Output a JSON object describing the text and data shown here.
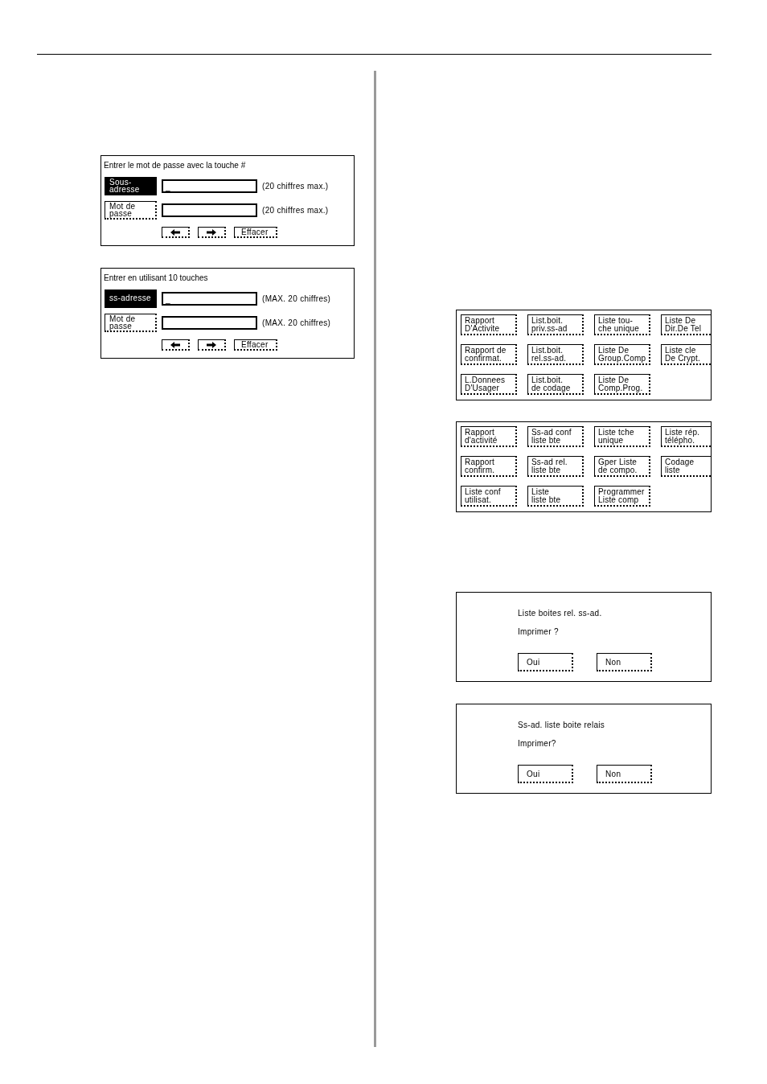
{
  "password_panels": [
    {
      "title": "Entrer le mot de passe avec la touche #",
      "rows": [
        {
          "key": "Sous-\nadresse",
          "selected": true,
          "value": "_",
          "note": "(20 chiffres max.)"
        },
        {
          "key": "Mot de\npasse",
          "selected": false,
          "note": "(20 chiffres max.)"
        }
      ],
      "controls": [
        {
          "kind": "arrow_left"
        },
        {
          "kind": "arrow_right"
        },
        {
          "kind": "text",
          "label": "Effacer"
        }
      ]
    },
    {
      "title": "Entrer en utilisant 10 touches",
      "rows": [
        {
          "key": "ss-adresse",
          "selected": true,
          "value": "_",
          "note": "(MAX. 20 chiffres)"
        },
        {
          "key": "Mot de\npasse",
          "selected": false,
          "note": "(MAX. 20 chiffres)"
        }
      ],
      "controls": [
        {
          "kind": "arrow_left"
        },
        {
          "kind": "arrow_right"
        },
        {
          "kind": "text",
          "label": "Effacer"
        }
      ]
    }
  ],
  "report_panels": [
    {
      "buttons": [
        "Rapport\nD'Activite",
        "List.boit.\npriv.ss-ad",
        "Liste tou-\nche unique",
        "Liste De\nDir.De Tel",
        "Rapport de\nconfirmat.",
        "List.boit.\nrel.ss-ad.",
        "Liste De\nGroup.Comp",
        "Liste cle\nDe Crypt.",
        "L.Donnees\nD'Usager",
        "List.boit.\nde codage",
        "Liste De\nComp.Prog."
      ]
    },
    {
      "buttons": [
        "Rapport\nd'activité",
        "Ss-ad conf\nliste bte",
        "Liste tche\nunique",
        "Liste rép.\ntélépho.",
        "Rapport\nconfirm.",
        "Ss-ad rel.\nliste bte",
        "Gper Liste\nde compo.",
        "Codage\nliste",
        "Liste conf\nutilisat.",
        "Liste\nliste bte",
        "Programmer\nListe comp"
      ]
    }
  ],
  "dialogs": [
    {
      "message": "Liste boites rel. ss-ad.",
      "question": "Imprimer ?",
      "buttons": [
        "Oui",
        "Non"
      ]
    },
    {
      "message": "Ss-ad. liste boite relais",
      "question": "Imprimer?",
      "buttons": [
        "Oui",
        "Non"
      ]
    }
  ]
}
